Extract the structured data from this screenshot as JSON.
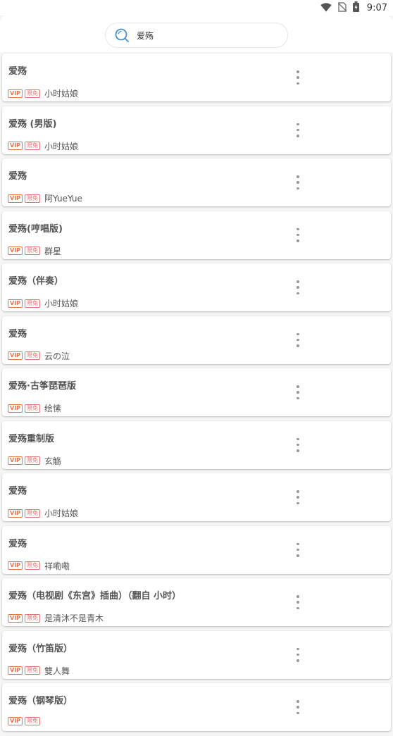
{
  "status": {
    "time": "9:07",
    "icons": [
      "wifi-icon",
      "no-sim-icon",
      "battery-icon"
    ]
  },
  "search": {
    "query": "爱殇",
    "icon": "search-icon"
  },
  "colors": {
    "vip_badge": "#e8734a",
    "free_badge": "#e57373",
    "search_icon": "#4a90c8"
  },
  "badges": {
    "vip": "VIP",
    "free": "限免"
  },
  "songs": [
    {
      "title": "爱殇",
      "artist": "小时姑娘"
    },
    {
      "title": "爱殇 (男版)",
      "artist": "小时姑娘"
    },
    {
      "title": "爱殇",
      "artist": "阿YueYue"
    },
    {
      "title": "爱殇(哼唱版)",
      "artist": "群星"
    },
    {
      "title": "爱殇（伴奏）",
      "artist": "小时姑娘"
    },
    {
      "title": "爱殇",
      "artist": "云の泣"
    },
    {
      "title": "爱殇·古筝琵琶版",
      "artist": "绘愫"
    },
    {
      "title": "爱殇重制版",
      "artist": "玄觞"
    },
    {
      "title": "爱殇",
      "artist": "小时姑娘"
    },
    {
      "title": "爱殇",
      "artist": "祥嘞嘞"
    },
    {
      "title": "爱殇（电视剧《东宫》插曲）（翻自 小时）",
      "artist": "是清沐不是青木"
    },
    {
      "title": "爱殇（竹笛版）",
      "artist": "雙人舞"
    },
    {
      "title": "爱殇（钢琴版）",
      "artist": ""
    }
  ]
}
